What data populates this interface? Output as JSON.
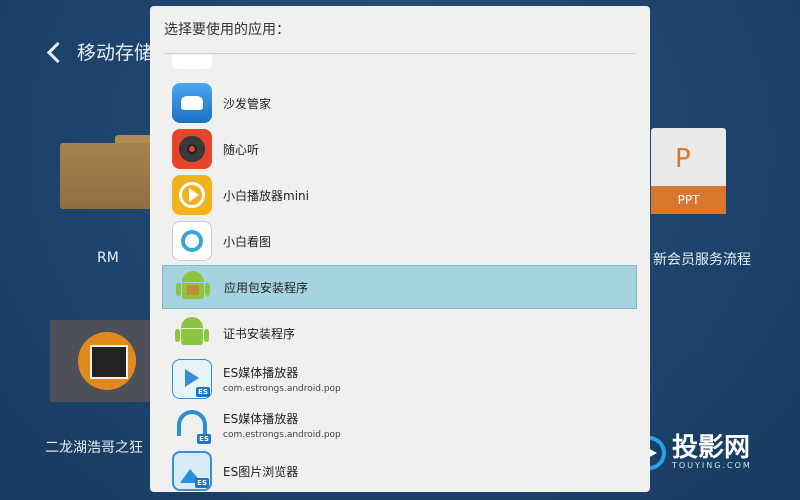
{
  "background": {
    "header_title": "移动存储",
    "items": [
      {
        "label": "RM"
      },
      {
        "label": "二龙湖浩哥之狂"
      },
      {
        "label": "新会员服务流程",
        "badge": "PPT"
      }
    ],
    "watermark": {
      "name": "投影网",
      "domain": "TOUYING.COM"
    }
  },
  "dialog": {
    "title": "选择要使用的应用：",
    "apps": [
      {
        "name": "",
        "package": "",
        "icon": "app-icon-partial"
      },
      {
        "name": "沙发管家",
        "package": "",
        "icon": "sofa-icon"
      },
      {
        "name": "随心听",
        "package": "",
        "icon": "record-icon"
      },
      {
        "name": "小白播放器mini",
        "package": "",
        "icon": "play-icon"
      },
      {
        "name": "小白看图",
        "package": "",
        "icon": "image-viewer-icon"
      },
      {
        "name": "应用包安装程序",
        "package": "",
        "icon": "android-icon",
        "selected": true
      },
      {
        "name": "证书安装程序",
        "package": "",
        "icon": "android-icon"
      },
      {
        "name": "ES媒体播放器",
        "package": "com.estrongs.android.pop",
        "icon": "es-video-icon"
      },
      {
        "name": "ES媒体播放器",
        "package": "com.estrongs.android.pop",
        "icon": "es-headphone-icon"
      },
      {
        "name": "ES图片浏览器",
        "package": "",
        "icon": "es-gallery-icon"
      }
    ]
  },
  "colors": {
    "selected_row": "#a5d4e0",
    "dialog_bg": "#f0f1ee",
    "background": "#1f4670"
  }
}
